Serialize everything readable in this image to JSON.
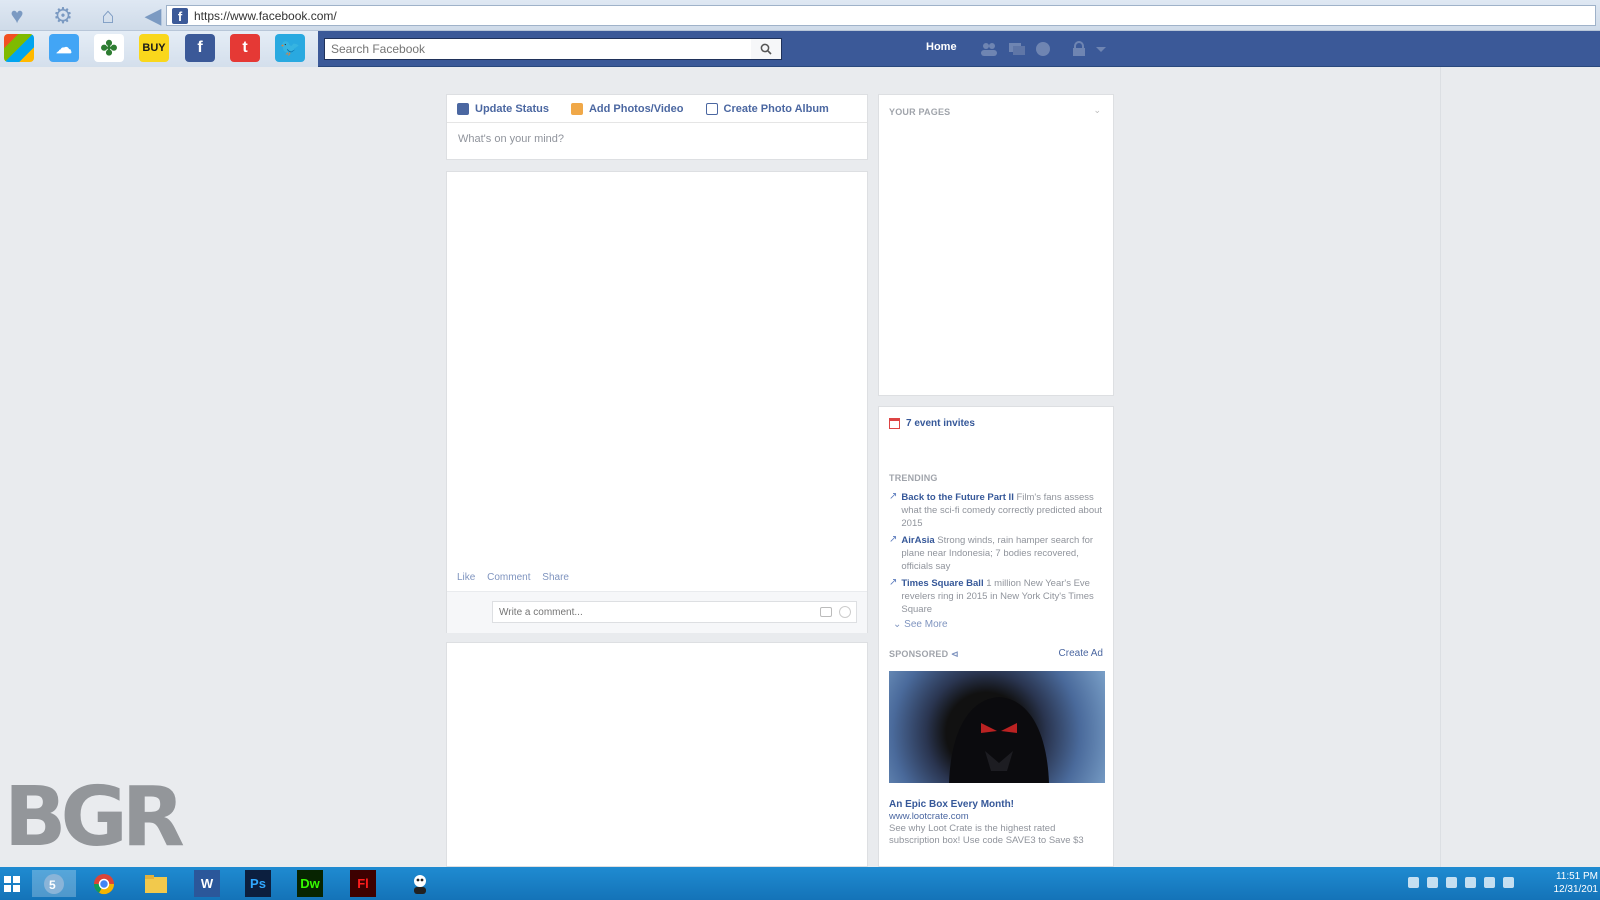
{
  "browser": {
    "url": "https://www.facebook.com/",
    "icons": [
      "favorites-heart-icon",
      "gear-icon",
      "home-icon",
      "back-arrow-icon"
    ]
  },
  "bookmarks": [
    {
      "name": "windows-bookmark",
      "label": "",
      "color": "#1e88e5"
    },
    {
      "name": "cloud-bookmark",
      "label": "",
      "color": "#42a5f5"
    },
    {
      "name": "clover-bookmark",
      "label": "",
      "color": "#2e7d32"
    },
    {
      "name": "bestbuy-bookmark",
      "label": "BUY",
      "color": "#f9d71c"
    },
    {
      "name": "facebook-bookmark",
      "label": "f",
      "color": "#3b5998"
    },
    {
      "name": "t-bookmark",
      "label": "t",
      "color": "#e53935"
    },
    {
      "name": "twitter-bookmark",
      "label": "",
      "color": "#29a9e0"
    }
  ],
  "header": {
    "search_placeholder": "Search Facebook",
    "home_label": "Home"
  },
  "composer": {
    "tab_update": "Update Status",
    "tab_photos": "Add Photos/Video",
    "tab_album": "Create Photo Album",
    "placeholder": "What's on your mind?"
  },
  "post": {
    "like": "Like",
    "comment": "Comment",
    "share": "Share",
    "comment_placeholder": "Write a comment..."
  },
  "sidebar": {
    "your_pages": "YOUR PAGES",
    "event_invites": "7 event invites",
    "trending_title": "TRENDING",
    "trending": [
      {
        "title": "Back to the Future Part II",
        "desc": "Film's fans assess what the sci-fi comedy correctly predicted about 2015"
      },
      {
        "title": "AirAsia",
        "desc": "Strong winds, rain hamper search for plane near Indonesia; 7 bodies recovered, officials say"
      },
      {
        "title": "Times Square Ball",
        "desc": "1 million New Year's Eve revelers ring in 2015 in New York City's Times Square"
      }
    ],
    "see_more": "See More",
    "sponsored": "SPONSORED",
    "create_ad": "Create Ad",
    "ad_headline": "An Epic Box Every Month!",
    "ad_url": "www.lootcrate.com",
    "ad_desc": "See why Loot Crate is the highest rated subscription box! Use code SAVE3 to Save $3"
  },
  "watermark": "BGR",
  "taskbar": {
    "apps": [
      "windows-start",
      "browser-app",
      "chrome-app",
      "file-explorer-app",
      "word-app",
      "photoshop-app",
      "dreamweaver-app",
      "flash-app",
      "messenger-app"
    ],
    "labels": {
      "word": "W",
      "photoshop": "Ps",
      "dreamweaver": "Dw",
      "flash": "Fl"
    },
    "time": "11:51 PM",
    "date": "12/31/201"
  },
  "colors": {
    "facebook_blue": "#3b5998",
    "link_blue": "#365899",
    "taskbar_blue": "#1a7fc6",
    "page_bg": "#e9ebee"
  }
}
